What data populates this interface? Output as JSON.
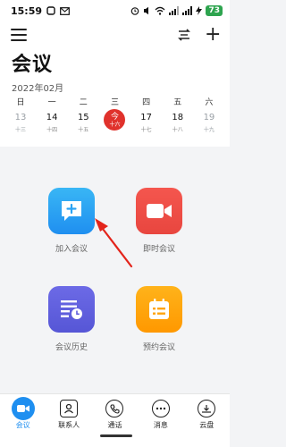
{
  "status_bar": {
    "time": "15:59",
    "battery": "73"
  },
  "header": {
    "title": "会议",
    "month": "2022年02月"
  },
  "calendar": {
    "days": [
      {
        "weekday": "日",
        "date": "13",
        "lunar": "十三"
      },
      {
        "weekday": "一",
        "date": "14",
        "lunar": "十四"
      },
      {
        "weekday": "二",
        "date": "15",
        "lunar": "十五"
      },
      {
        "weekday": "三",
        "date": "今",
        "lunar": "十六"
      },
      {
        "weekday": "四",
        "date": "17",
        "lunar": "十七"
      },
      {
        "weekday": "五",
        "date": "18",
        "lunar": "十八"
      },
      {
        "weekday": "六",
        "date": "19",
        "lunar": "十九"
      }
    ]
  },
  "actions": {
    "join": "加入会议",
    "instant": "即时会议",
    "history": "会议历史",
    "schedule": "预约会议"
  },
  "nav": {
    "meeting": "会议",
    "contacts": "联系人",
    "calls": "通话",
    "messages": "消息",
    "cloud": "云盘"
  },
  "colors": {
    "accent": "#1f8ff0",
    "today": "#e0322c",
    "join": "#2ba3f3",
    "instant": "#f04e47",
    "history": "#5f5ddd",
    "schedule": "#ffa40d"
  }
}
